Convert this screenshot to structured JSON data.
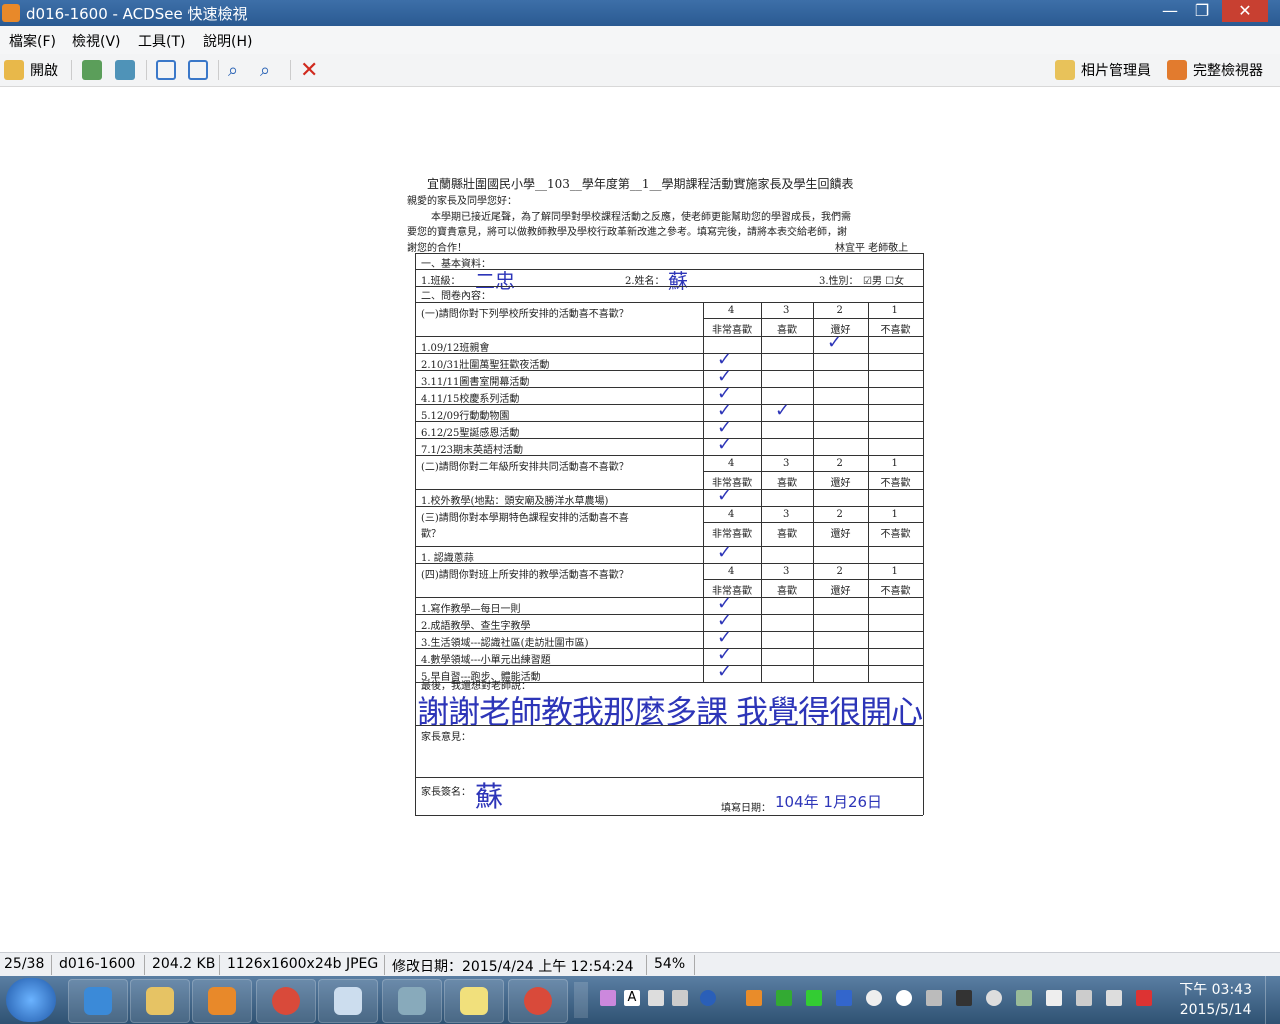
{
  "window": {
    "title": "d016-1600 - ACDSee 快速檢視"
  },
  "menu": [
    "檔案(F)",
    "檢視(V)",
    "工具(T)",
    "說明(H)"
  ],
  "toolbar": {
    "open_label": "開啟",
    "photo_manager_label": "相片管理員",
    "full_viewer_label": "完整檢視器"
  },
  "doc": {
    "title": "宜蘭縣壯圍國民小學__103__學年度第__1__學期課程活動實施家長及學生回饋表",
    "greeting": "親愛的家長及同學您好：",
    "intro1": "本學期已接近尾聲，為了解同學對學校課程活動之反應，使老師更能幫助您的學習成長，我們需",
    "intro2": "要您的寶貴意見，將可以做教師教學及學校行政革新改進之參考。填寫完後，請將本表交給老師，謝",
    "intro3": "謝您的合作！",
    "signoff": "林宜平 老師敬上",
    "sec1": "一、基本資料：",
    "class_label": "1.班級：",
    "name_label": "2.姓名：",
    "gender_label": "3.性別：",
    "male": "男",
    "female": "女",
    "sec2": "二、問卷內容：",
    "q1": "(一)請問你對下列學校所安排的活動喜不喜歡？",
    "q2": "(二)請問你對二年級所安排共同活動喜不喜歡？",
    "q3a": "(三)請問你對本學期特色課程安排的活動喜不喜",
    "q3b": "歡？",
    "q4": "(四)請問你對班上所安排的教學活動喜不喜歡？",
    "scale": [
      "4",
      "3",
      "2",
      "1"
    ],
    "scale_labels": [
      "非常喜歡",
      "喜歡",
      "還好",
      "不喜歡"
    ],
    "items1": [
      "1.09/12班親會",
      "2.10/31壯圍萬聖狂歡夜活動",
      "3.11/11圖書室開幕活動",
      "4.11/15校慶系列活動",
      "5.12/09行動動物園",
      "6.12/25聖誕感恩活動",
      "7.1/23期末英語村活動"
    ],
    "items2": [
      "1.校外教學(地點：頭安廟及勝洋水草農場)"
    ],
    "items3": [
      "1.  認識蔥蒜"
    ],
    "items4": [
      "1.寫作教學—每日一則",
      "2.成語教學、查生字教學",
      "3.生活領域---認識社區(走訪壯圍市區)",
      "4.數學領域---小單元出練習題",
      "5.早自習---跑步、體能活動"
    ],
    "final_label": "最後，我還想對老師說：",
    "parent_opinion": "家長意見：",
    "parent_sign": "家長簽名：",
    "fill_date": "填寫日期：",
    "hw_class": "二忠",
    "hw_name": "蘇",
    "hw_comment": "謝謝老師教我那麼多課 我覺得很開心",
    "hw_sign": "蘇",
    "hw_date": "104年 1月26日"
  },
  "status": {
    "index": "25/38",
    "filename": "d016-1600",
    "size": "204.2 KB",
    "dims": "1126x1600x24b JPEG",
    "modified": "修改日期：2015/4/24 上午 12:54:24",
    "zoom": "54%"
  },
  "clock": {
    "time": "下午 03:43",
    "date": "2015/5/14"
  }
}
